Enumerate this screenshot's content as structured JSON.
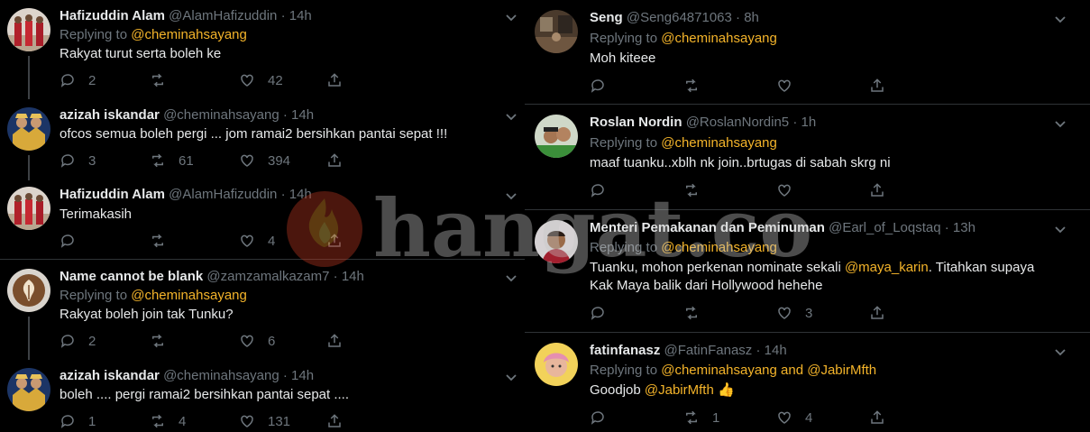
{
  "left_tweets": [
    {
      "name": "Hafizuddin Alam",
      "handle": "@AlamHafizuddin",
      "time": "14h",
      "reply_label": "Replying to",
      "reply_mentions": [
        "@cheminahsayang"
      ],
      "text": "Rakyat turut serta boleh ke",
      "replies": "2",
      "retweets": "",
      "likes": "42",
      "avatar": "group-photo-avatar"
    },
    {
      "name": "azizah iskandar",
      "handle": "@cheminahsayang",
      "time": "14h",
      "text": "ofcos semua boleh pergi ... jom ramai2 bersihkan pantai sepat !!!",
      "replies": "3",
      "retweets": "61",
      "likes": "394",
      "avatar": "royal-couple-avatar"
    },
    {
      "name": "Hafizuddin Alam",
      "handle": "@AlamHafizuddin",
      "time": "14h",
      "text": "Terimakasih",
      "replies": "",
      "retweets": "",
      "likes": "4",
      "avatar": "group-photo-avatar"
    },
    {
      "name": "Name cannot be blank",
      "handle": "@zamzamalkazam7",
      "time": "14h",
      "reply_label": "Replying to",
      "reply_mentions": [
        "@cheminahsayang"
      ],
      "text": "Rakyat boleh join tak Tunku?",
      "replies": "2",
      "retweets": "",
      "likes": "6",
      "avatar": "coffee-avatar"
    },
    {
      "name": "azizah iskandar",
      "handle": "@cheminahsayang",
      "time": "14h",
      "text": "boleh .... pergi ramai2 bersihkan pantai sepat ....",
      "replies": "1",
      "retweets": "4",
      "likes": "131",
      "avatar": "royal-couple-avatar"
    }
  ],
  "right_tweets": [
    {
      "name": "Seng",
      "handle": "@Seng64871063",
      "time": "8h",
      "reply_label": "Replying to",
      "reply_mentions": [
        "@cheminahsayang"
      ],
      "text": "Moh kiteee",
      "replies": "",
      "retweets": "",
      "likes": "",
      "avatar": "room-photo-avatar"
    },
    {
      "name": "Roslan Nordin",
      "handle": "@RoslanNordin5",
      "time": "1h",
      "reply_label": "Replying to",
      "reply_mentions": [
        "@cheminahsayang"
      ],
      "text": "maaf tuanku..xblh nk join..brtugas di sabah skrg ni",
      "replies": "",
      "retweets": "",
      "likes": "",
      "avatar": "selfie-avatar"
    },
    {
      "name": "Menteri Pemakanan dan Peminuman",
      "handle": "@Earl_of_Loqstaq",
      "time": "13h",
      "reply_label": "Replying to",
      "reply_mentions": [
        "@cheminahsayang"
      ],
      "text_line1_a": "Tuanku, mohon perkenan nominate sekali ",
      "text_line1_mention": "@maya_karin",
      "text_line1_b": ". Titahkan supaya",
      "text_line2": "Kak Maya balik dari Hollywood hehehe",
      "replies": "",
      "retweets": "",
      "likes": "3",
      "avatar": "man-avatar"
    },
    {
      "name": "fatinfanasz",
      "handle": "@FatinFanasz",
      "time": "14h",
      "reply_label": "Replying to",
      "reply_mentions": [
        "@cheminahsayang",
        "@JabirMfth"
      ],
      "reply_and": "and",
      "text_a": "Goodjob ",
      "text_mention": "@JabirMfth",
      "text_emoji": "👍",
      "replies": "",
      "retweets": "1",
      "likes": "4",
      "avatar": "girl-avatar"
    }
  ],
  "watermark": {
    "text": "hangat.com",
    "icon": "flame-icon"
  },
  "colors": {
    "background": "#000000",
    "mention": "#f4b42a",
    "muted": "#6e767d",
    "text": "#e7e9ea",
    "divider": "#2f3336"
  }
}
